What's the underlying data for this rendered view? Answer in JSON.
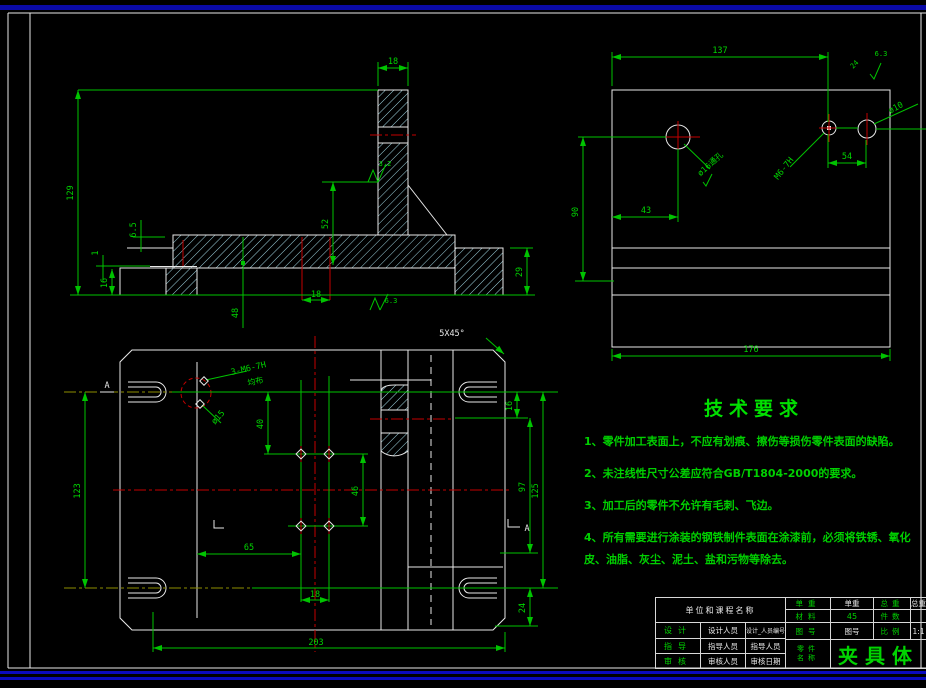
{
  "tech": {
    "title": "技术要求",
    "items": [
      "1、零件加工表面上，不应有划痕、擦伤等损伤零件表面的缺陷。",
      "2、未注线性尺寸公差应符合GB/T1804-2000的要求。",
      "3、加工后的零件不允许有毛刺、飞边。",
      "4、所有需要进行涂装的钢铁制件表面在涂漆前，必须将铁锈、氧化皮、油脂、灰尘、泥土、盐和污物等除去。"
    ]
  },
  "title_block": {
    "org": "单位和课程名称",
    "left": {
      "design_label": "设计",
      "designer": "设计人员",
      "designer_no": "设计_人员编号",
      "advise_label": "指导",
      "adviser": "指导人员",
      "adviser_dup": "指导人员",
      "review_label": "审核",
      "reviewer": "审核人员",
      "review_date": "审核日期"
    },
    "right": {
      "unit_weight_label": "单重",
      "unit_weight_value": "单重",
      "total_weight_label": "总重",
      "total_weight_value": "总重",
      "material_label": "材料",
      "material_value": "45",
      "qty_label": "件数",
      "dwg_label": "图号",
      "dwg_value": "图号",
      "scale_label": "比例",
      "scale_value": "1:1",
      "part_label_line1": "零件",
      "part_label_line2": "名称",
      "part_name": "夹具体"
    }
  },
  "front_view": {
    "dims": {
      "w18": "18",
      "h129": "129",
      "d65": "6.5",
      "d1": "1",
      "d16": "16",
      "d52": "52",
      "d48": "48",
      "d18b": "18",
      "d29": "29"
    },
    "finish": {
      "f32": "3.2",
      "f63": "6.3"
    }
  },
  "side_view": {
    "dims": {
      "w137": "137",
      "h90": "90",
      "d43": "43",
      "d54": "54",
      "w176": "176"
    },
    "holes": {
      "h1": "ø16通孔",
      "h2": "M6-7H",
      "h3": "ø10"
    },
    "finish": {
      "f63": "6.3",
      "f24": "24"
    }
  },
  "plan_view": {
    "dims": {
      "h123": "123",
      "d40": "40",
      "d46": "46",
      "d65": "65",
      "d18": "18",
      "w203": "203",
      "d16": "16",
      "d97": "97",
      "d125": "125",
      "d24": "24"
    },
    "notes": {
      "thread": "3-M6-7H",
      "even": "均布",
      "dia": "ø15",
      "chamfer": "5X45°",
      "section_a": "A"
    }
  }
}
